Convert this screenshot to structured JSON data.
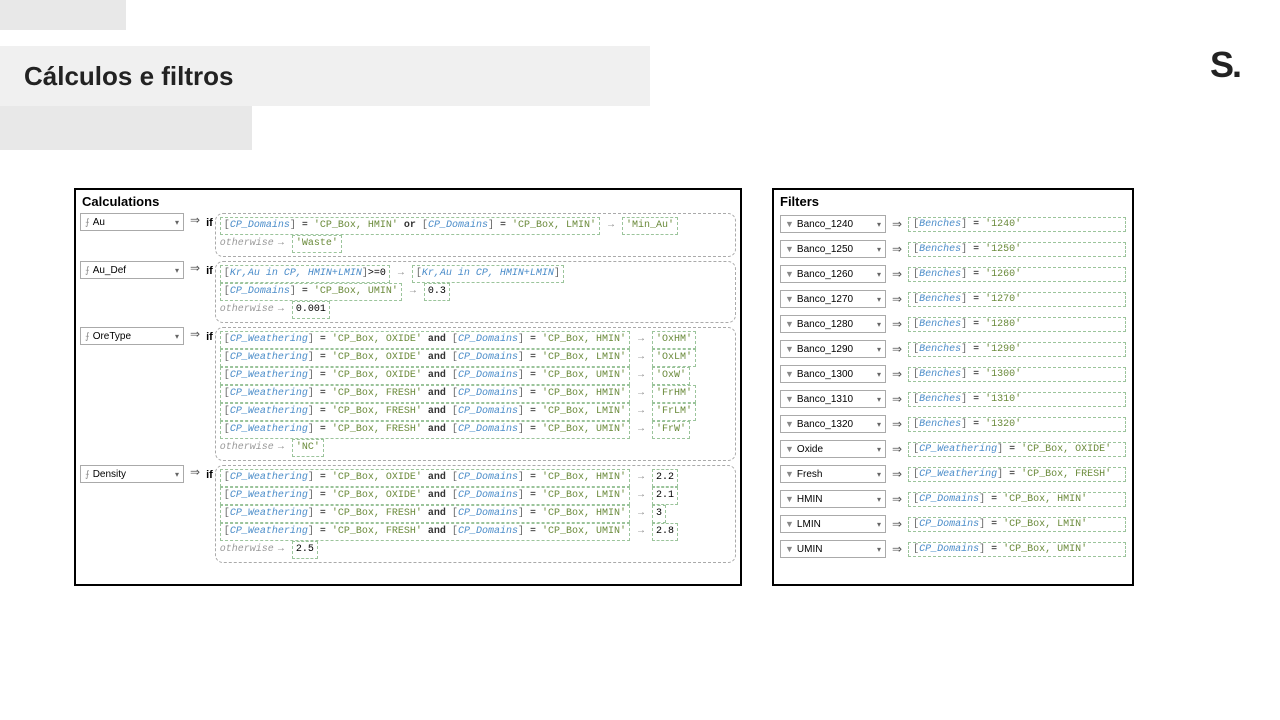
{
  "title": "Cálculos e filtros",
  "logo_text": "S.",
  "calc_header": "Calculations",
  "filters_header": "Filters",
  "if_label": "if",
  "otherwise": "otherwise",
  "calculations": [
    {
      "name": "Au",
      "rules": [
        {
          "cond": "[CP_Domains] = 'CP_Box, HMIN' or [CP_Domains] = 'CP_Box, LMIN'",
          "result": "'Min_Au'"
        },
        {
          "cond": "otherwise",
          "result": "'Waste'"
        }
      ]
    },
    {
      "name": "Au_Def",
      "rules": [
        {
          "cond": "[Kr,Au in CP, HMIN+LMIN]>=0",
          "result": "[Kr,Au in CP, HMIN+LMIN]"
        },
        {
          "cond": "[CP_Domains] = 'CP_Box, UMIN'",
          "result": "0.3"
        },
        {
          "cond": "otherwise",
          "result": "0.001"
        }
      ]
    },
    {
      "name": "OreType",
      "rules": [
        {
          "cond": "[CP_Weathering] = 'CP_Box, OXIDE' and [CP_Domains] = 'CP_Box, HMIN'",
          "result": "'OxHM'"
        },
        {
          "cond": "[CP_Weathering] = 'CP_Box, OXIDE' and [CP_Domains] = 'CP_Box, LMIN'",
          "result": "'OxLM'"
        },
        {
          "cond": "[CP_Weathering] = 'CP_Box, OXIDE' and [CP_Domains] = 'CP_Box, UMIN'",
          "result": "'OxW'"
        },
        {
          "cond": "[CP_Weathering] = 'CP_Box, FRESH' and [CP_Domains] = 'CP_Box, HMIN'",
          "result": "'FrHM'"
        },
        {
          "cond": "[CP_Weathering] = 'CP_Box, FRESH' and [CP_Domains] = 'CP_Box, LMIN'",
          "result": "'FrLM'"
        },
        {
          "cond": "[CP_Weathering] = 'CP_Box, FRESH' and [CP_Domains] = 'CP_Box, UMIN'",
          "result": "'FrW'"
        },
        {
          "cond": "otherwise",
          "result": "'NC'"
        }
      ]
    },
    {
      "name": "Density",
      "rules": [
        {
          "cond": "[CP_Weathering] = 'CP_Box, OXIDE' and [CP_Domains] = 'CP_Box, HMIN'",
          "result": "2.2"
        },
        {
          "cond": "[CP_Weathering] = 'CP_Box, OXIDE' and [CP_Domains] = 'CP_Box, LMIN'",
          "result": "2.1"
        },
        {
          "cond": "[CP_Weathering] = 'CP_Box, FRESH' and [CP_Domains] = 'CP_Box, HMIN'",
          "result": "3"
        },
        {
          "cond": "[CP_Weathering] = 'CP_Box, FRESH' and [CP_Domains] = 'CP_Box, UMIN'",
          "result": "2.8"
        },
        {
          "cond": "otherwise",
          "result": "2.5"
        }
      ]
    }
  ],
  "filters": [
    {
      "name": "Banco_1240",
      "cond": "[Benches] = '1240'"
    },
    {
      "name": "Banco_1250",
      "cond": "[Benches] = '1250'"
    },
    {
      "name": "Banco_1260",
      "cond": "[Benches] = '1260'"
    },
    {
      "name": "Banco_1270",
      "cond": "[Benches] = '1270'"
    },
    {
      "name": "Banco_1280",
      "cond": "[Benches] = '1280'"
    },
    {
      "name": "Banco_1290",
      "cond": "[Benches] = '1290'"
    },
    {
      "name": "Banco_1300",
      "cond": "[Benches] = '1300'"
    },
    {
      "name": "Banco_1310",
      "cond": "[Benches] = '1310'"
    },
    {
      "name": "Banco_1320",
      "cond": "[Benches] = '1320'"
    },
    {
      "name": "Oxide",
      "cond": "[CP_Weathering] = 'CP_Box, OXIDE'"
    },
    {
      "name": "Fresh",
      "cond": "[CP_Weathering] = 'CP_Box, FRESH'"
    },
    {
      "name": "HMIN",
      "cond": "[CP_Domains] = 'CP_Box, HMIN'"
    },
    {
      "name": "LMIN",
      "cond": "[CP_Domains] = 'CP_Box, LMIN'"
    },
    {
      "name": "UMIN",
      "cond": "[CP_Domains] = 'CP_Box, UMIN'"
    }
  ]
}
